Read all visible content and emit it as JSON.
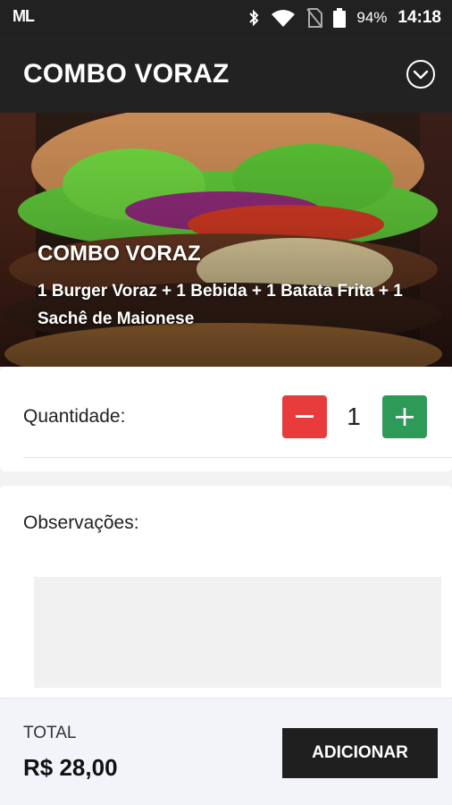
{
  "status": {
    "carrier_logo": "ML",
    "battery": "94%",
    "time": "14:18"
  },
  "header": {
    "title": "COMBO VORAZ",
    "toggle_icon": "chevron-down-circle-icon"
  },
  "product": {
    "name": "COMBO VORAZ",
    "description": "1 Burger Voraz + 1 Bebida + 1 Batata Frita + 1 Sachê de Maionese"
  },
  "quantity": {
    "label": "Quantidade:",
    "value": "1",
    "minus_color": "#e83b3b",
    "plus_color": "#2e9a58"
  },
  "notes": {
    "label": "Observações:",
    "placeholder": ""
  },
  "footer": {
    "total_label": "TOTAL",
    "total_value": "R$ 28,00",
    "add_label": "ADICIONAR"
  }
}
